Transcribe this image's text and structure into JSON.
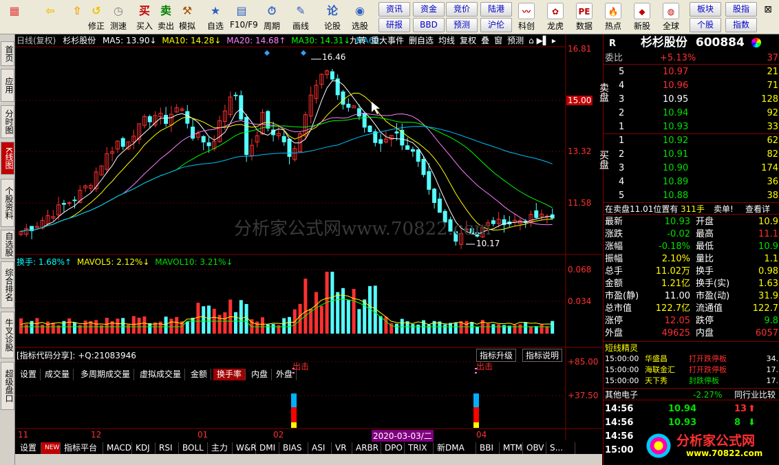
{
  "toolbar": {
    "buttons": [
      {
        "label": "",
        "icon": "app-grid-icon"
      },
      {
        "label": "",
        "icon": "back-arrow-icon"
      },
      {
        "label": "",
        "icon": "up-arrow-icon"
      },
      {
        "label": "修正",
        "icon": "fix-icon"
      },
      {
        "label": "测速",
        "icon": "clock-icon"
      },
      {
        "label": "买入",
        "icon": "buy-icon",
        "glyph": "买"
      },
      {
        "label": "卖出",
        "icon": "sell-icon",
        "glyph": "卖"
      },
      {
        "label": "模拟",
        "icon": "hammer-icon"
      },
      {
        "label": "自选",
        "icon": "star-icon"
      },
      {
        "label": "F10/F9",
        "icon": "f10-icon"
      },
      {
        "label": "周期",
        "icon": "period-icon"
      },
      {
        "label": "画线",
        "icon": "pencil-icon"
      },
      {
        "label": "论股",
        "icon": "discuss-icon",
        "glyph": "论"
      },
      {
        "label": "选股",
        "icon": "select-stock-icon"
      }
    ],
    "small_buttons": [
      [
        "资讯",
        "资金",
        "竞价",
        "陆港"
      ],
      [
        "研报",
        "BBD",
        "预测",
        "沪伦"
      ]
    ],
    "buttons2": [
      {
        "label": "科创",
        "icon": "kechuang-icon"
      },
      {
        "label": "龙虎",
        "icon": "dragon-tiger-icon"
      },
      {
        "label": "数据",
        "icon": "pe-data-icon",
        "glyph": "PE"
      },
      {
        "label": "热点",
        "icon": "hot-icon"
      },
      {
        "label": "新股",
        "icon": "new-stock-icon"
      },
      {
        "label": "全球",
        "icon": "globe-icon"
      }
    ],
    "small_buttons2": [
      [
        "板块",
        "股指"
      ],
      [
        "个股",
        "指数"
      ]
    ],
    "colors": {
      "buy": "#c00000",
      "sell": "#008000"
    }
  },
  "left_tabs": [
    "首页",
    "应用",
    "分时图",
    "K线图",
    "个股资料",
    "自选股",
    "综合排名",
    "牛叉诊股",
    "超级盘口"
  ],
  "active_left_tab": 3,
  "chart": {
    "header": {
      "period": "日线(复权)",
      "stock": "杉杉股份",
      "ma5": "MA5: 13.90↓",
      "ma10": "MA10: 14.28↓",
      "ma20": "MA20: 14.68↑",
      "ma30": "MA30: 14.31↓",
      "ma60": "MA60:"
    },
    "tools": [
      "九转",
      "重大事件",
      "删自选",
      "均线",
      "复权",
      "叠",
      "窗",
      "预测"
    ],
    "price_axis": [
      "16.81",
      "15.00",
      "13.32",
      "11.58"
    ],
    "high_label": "16.46",
    "low_label": "10.17",
    "watermark": "分析家公式网www.70822.com",
    "vol_header": {
      "name": "换手: 1.68%↑",
      "mavol5": "MAVOL5: 2.12%↓",
      "mavol10": "MAVOL10: 3.21%↓"
    },
    "vol_axis": [
      "0.068",
      "0.034"
    ],
    "panel_tabs": [
      "设置",
      "成交量",
      "多周期成交量",
      "虚拟成交量",
      "金额",
      "换手率",
      "内盘",
      "外盘"
    ],
    "active_panel_tab": 5,
    "ind_header": "[指标代码分享]: +Q:21083946",
    "ind_buttons": [
      "指标升级",
      "指标说明"
    ],
    "ind_axis": [
      "+85.00",
      "+37.50"
    ],
    "signal_label": "出击",
    "date_axis": [
      "11",
      "12",
      "01",
      "02",
      "03",
      "04"
    ],
    "cursor_date": "2020-03-03/二",
    "bottom_tabs": [
      "设置",
      "指标平台",
      "MACD",
      "KDJ",
      "RSI",
      "BOLL",
      "主力",
      "W&R",
      "DMI",
      "BIAS",
      "ASI",
      "VR",
      "ARBR",
      "DPO",
      "TRIX",
      "新DMA",
      "BBI",
      "MTM",
      "OBV",
      "S..."
    ],
    "new_badge": "NEW",
    "colors": {
      "up": "#ff3030",
      "down": "#54ffff",
      "ma5": "#ffffff",
      "ma10": "#ffff00",
      "ma20": "#ff80ff",
      "ma30": "#00ff00",
      "ma60": "#00c0ff"
    }
  },
  "quote": {
    "stock_name": "杉杉股份",
    "code": "600884",
    "weibi": {
      "label": "委比",
      "value": "+5.13%",
      "extra": "37"
    },
    "sell": [
      {
        "n": "5",
        "p": "10.97",
        "v": "21"
      },
      {
        "n": "4",
        "p": "10.96",
        "v": "71"
      },
      {
        "n": "3",
        "p": "10.95",
        "v": "128"
      },
      {
        "n": "2",
        "p": "10.94",
        "v": "92"
      },
      {
        "n": "1",
        "p": "10.93",
        "v": "33"
      }
    ],
    "buy": [
      {
        "n": "1",
        "p": "10.92",
        "v": "62"
      },
      {
        "n": "2",
        "p": "10.91",
        "v": "82"
      },
      {
        "n": "3",
        "p": "10.90",
        "v": "174"
      },
      {
        "n": "4",
        "p": "10.89",
        "v": "36"
      },
      {
        "n": "5",
        "p": "10.88",
        "v": "38"
      }
    ],
    "sell_side": "卖盘",
    "buy_side": "买盘",
    "r_label": "R",
    "inline_msg": {
      "text": "在卖盘11.01位置有",
      "vol": "311手",
      "action": "卖单!",
      "link": "查看详"
    },
    "stats": [
      [
        "最新",
        "10.93",
        "开盘",
        "10.9"
      ],
      [
        "涨跌",
        "-0.02",
        "最高",
        "11.1"
      ],
      [
        "涨幅",
        "-0.18%",
        "最低",
        "10.9"
      ],
      [
        "振幅",
        "2.10%",
        "量比",
        "1.1"
      ],
      [
        "总手",
        "11.02万",
        "换手",
        "0.98"
      ],
      [
        "金额",
        "1.21亿",
        "换手(实)",
        "1.63"
      ],
      [
        "市盈(静)",
        "11.00",
        "市盈(动)",
        "31.9"
      ],
      [
        "总市值",
        "122.7亿",
        "流通值",
        "122.7"
      ],
      [
        "涨停",
        "12.05",
        "跌停",
        "9.8"
      ],
      [
        "外盘",
        "49625",
        "内盘",
        "6057"
      ]
    ],
    "sprite_title": "短线精灵",
    "sprites": [
      [
        "15:00:00",
        "华盛昌",
        "打开跌停板",
        "34."
      ],
      [
        "15:00:00",
        "海联金汇",
        "打开跌停板",
        "17."
      ],
      [
        "15:00:00",
        "天下秀",
        "封跌停板",
        "17."
      ]
    ],
    "sector": {
      "name": "其他电子",
      "pct": "-2.27%",
      "link": "同行业比较"
    },
    "ticks": [
      [
        "14:56",
        "10.94",
        "13"
      ],
      [
        "14:56",
        "10.93",
        "8"
      ],
      [
        "14:56",
        "",
        ""
      ],
      [
        "15:00",
        "",
        ""
      ]
    ],
    "logo_text": "分析家公式网",
    "logo_url": "www.70822.com"
  }
}
